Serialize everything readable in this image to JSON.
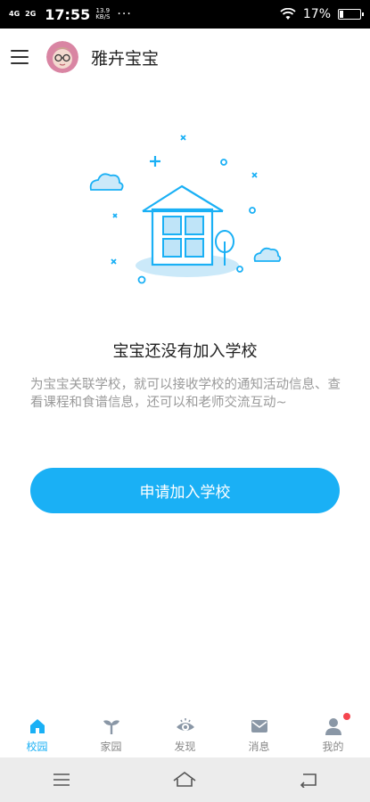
{
  "status_bar": {
    "network_top": "4G",
    "network_second": "2G",
    "time": "17:55",
    "speed_value": "13.9",
    "speed_unit": "KB/S",
    "dots": "···",
    "battery_percent": "17%",
    "battery_level": 0.17
  },
  "header": {
    "title": "雅卉宝宝"
  },
  "empty_state": {
    "title": "宝宝还没有加入学校",
    "description": "为宝宝关联学校，就可以接收学校的通知活动信息、查看课程和食谱信息，还可以和老师交流互动~",
    "button_label": "申请加入学校"
  },
  "tabs": [
    {
      "label": "校园",
      "icon": "school-home-icon",
      "active": true
    },
    {
      "label": "家园",
      "icon": "sprout-icon",
      "active": false
    },
    {
      "label": "发现",
      "icon": "eye-icon",
      "active": false
    },
    {
      "label": "消息",
      "icon": "mail-icon",
      "active": false
    },
    {
      "label": "我的",
      "icon": "person-icon",
      "active": false,
      "badge": true
    }
  ],
  "colors": {
    "accent": "#1ab0f5",
    "badge": "#f5454e",
    "inactive_icon": "#8a97a6"
  }
}
